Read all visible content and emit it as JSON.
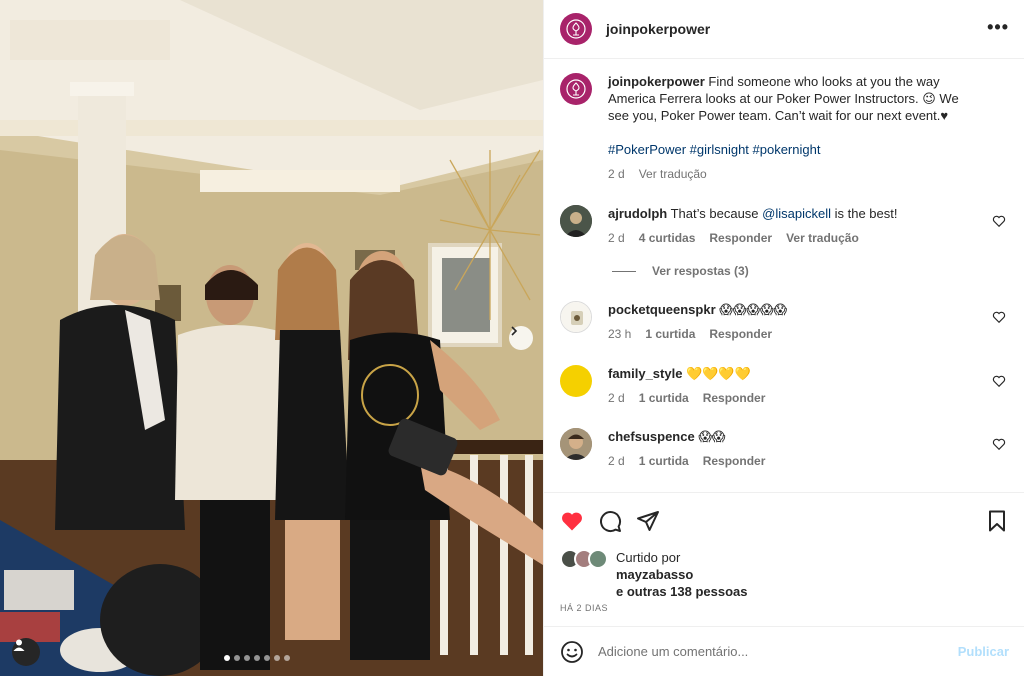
{
  "post": {
    "username": "joinpokerpower",
    "more_icon": "more-horizontal-icon",
    "caption": {
      "text": "Find someone who looks at you the way America Ferrera looks at our Poker Power Instructors. 😉 We see you, Poker Power team. Can’t wait for our next event.♥",
      "hashtags": "#PokerPower #girlsnight #pokernight",
      "time": "2 d",
      "translate": "Ver tradução"
    },
    "carousel": {
      "slide_count": 7,
      "active_index": 0
    }
  },
  "comments": [
    {
      "username": "ajrudolph",
      "text_before": "That’s because ",
      "mention": "@lisapickell",
      "text_after": " is the best!",
      "time": "2 d",
      "likes": "4 curtidas",
      "reply": "Responder",
      "translate": "Ver tradução",
      "view_replies": "Ver respostas (3)"
    },
    {
      "username": "pocketqueenspkr",
      "text": "😱😱😱😱😱",
      "time": "23 h",
      "likes": "1 curtida",
      "reply": "Responder"
    },
    {
      "username": "family_style",
      "text": "💛💛💛💛",
      "time": "2 d",
      "likes": "1 curtida",
      "reply": "Responder"
    },
    {
      "username": "chefsuspence",
      "text": "😱😱",
      "time": "2 d",
      "likes": "1 curtida",
      "reply": "Responder"
    }
  ],
  "actions": {
    "liked_by_label": "Curtido por",
    "liked_by_user": "mayzabasso",
    "others": "e outras 138 pessoas",
    "date": "HÁ 2 DIAS",
    "heart_color": "#ff3040"
  },
  "composer": {
    "placeholder": "Adicione um comentário...",
    "publish": "Publicar"
  },
  "colors": {
    "brand": "#a8236a",
    "link": "#00376b",
    "muted": "#737373"
  }
}
